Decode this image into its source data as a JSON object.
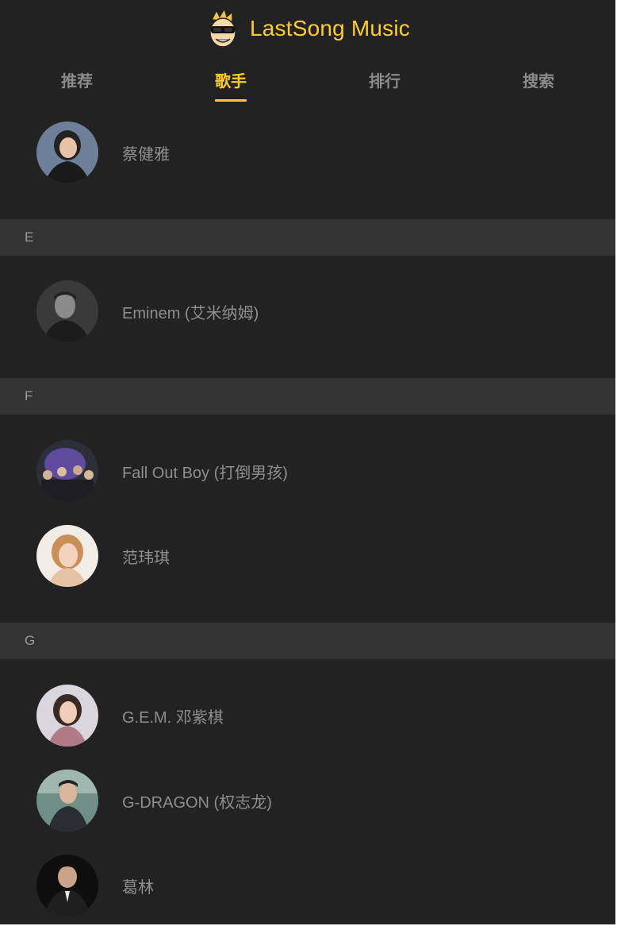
{
  "app": {
    "title": "LastSong Music",
    "accent": "#ffcd32",
    "logo_icon": "mascot-face-icon"
  },
  "tabs": [
    {
      "label": "推荐",
      "active": false
    },
    {
      "label": "歌手",
      "active": true
    },
    {
      "label": "排行",
      "active": false
    },
    {
      "label": "搜索",
      "active": false
    }
  ],
  "singers": {
    "top": {
      "name": "蔡健雅"
    },
    "groups": [
      {
        "letter": "E",
        "items": [
          {
            "name": "Eminem (艾米纳姆)"
          }
        ]
      },
      {
        "letter": "F",
        "items": [
          {
            "name": "Fall Out Boy (打倒男孩)"
          },
          {
            "name": "范玮琪"
          }
        ]
      },
      {
        "letter": "G",
        "items": [
          {
            "name": "G.E.M. 邓紫棋"
          },
          {
            "name": "G-DRAGON (权志龙)"
          },
          {
            "name": "葛林"
          }
        ]
      }
    ]
  }
}
